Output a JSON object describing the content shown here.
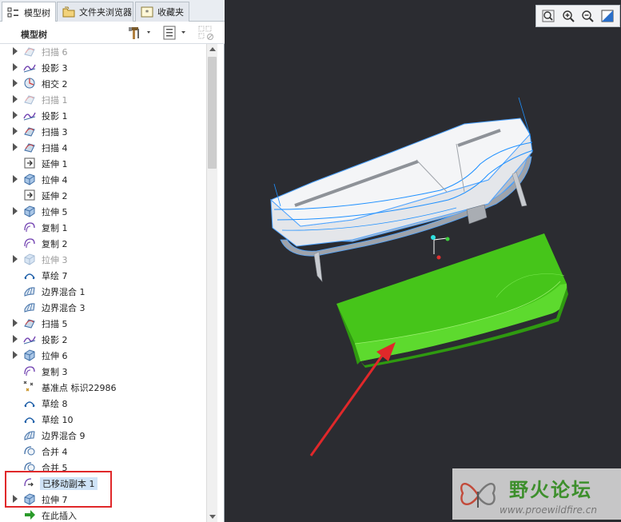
{
  "tabs": [
    {
      "label": "模型树",
      "icon": "tree-icon",
      "active": true
    },
    {
      "label": "文件夹浏览器",
      "icon": "folder-icon",
      "active": false
    },
    {
      "label": "收藏夹",
      "icon": "favorites-icon",
      "active": false
    }
  ],
  "tree_toolbar": {
    "title": "模型树",
    "settings_icon": "hammer-settings-icon",
    "show_icon": "list-show-icon",
    "filter_icon": "filter-icon"
  },
  "tree_items": [
    {
      "label": "扫描 6",
      "icon": "sweep-icon",
      "expandable": true,
      "dim": true
    },
    {
      "label": "投影 3",
      "icon": "project-icon",
      "expandable": true,
      "dim": false
    },
    {
      "label": "相交 2",
      "icon": "intersect-icon",
      "expandable": true,
      "dim": false
    },
    {
      "label": "扫描 1",
      "icon": "sweep-icon",
      "expandable": true,
      "dim": true
    },
    {
      "label": "投影 1",
      "icon": "project-icon",
      "expandable": true,
      "dim": false
    },
    {
      "label": "扫描 3",
      "icon": "sweep-icon",
      "expandable": true,
      "dim": false
    },
    {
      "label": "扫描 4",
      "icon": "sweep-icon",
      "expandable": true,
      "dim": false
    },
    {
      "label": "延伸 1",
      "icon": "extend-icon",
      "expandable": false,
      "dim": false
    },
    {
      "label": "拉伸 4",
      "icon": "extrude-icon",
      "expandable": true,
      "dim": false
    },
    {
      "label": "延伸 2",
      "icon": "extend-icon",
      "expandable": false,
      "dim": false
    },
    {
      "label": "拉伸 5",
      "icon": "extrude-icon",
      "expandable": true,
      "dim": false
    },
    {
      "label": "复制 1",
      "icon": "copy-icon",
      "expandable": false,
      "dim": false
    },
    {
      "label": "复制 2",
      "icon": "copy-icon",
      "expandable": false,
      "dim": false
    },
    {
      "label": "拉伸 3",
      "icon": "extrude-icon",
      "expandable": true,
      "dim": true
    },
    {
      "label": "草绘 7",
      "icon": "sketch-icon",
      "expandable": false,
      "dim": false
    },
    {
      "label": "边界混合 1",
      "icon": "boundary-blend-icon",
      "expandable": false,
      "dim": false
    },
    {
      "label": "边界混合 3",
      "icon": "boundary-blend-icon",
      "expandable": false,
      "dim": false
    },
    {
      "label": "扫描 5",
      "icon": "sweep-icon",
      "expandable": true,
      "dim": false
    },
    {
      "label": "投影 2",
      "icon": "project-icon",
      "expandable": true,
      "dim": false
    },
    {
      "label": "拉伸 6",
      "icon": "extrude-icon",
      "expandable": true,
      "dim": false
    },
    {
      "label": "复制 3",
      "icon": "copy-icon",
      "expandable": false,
      "dim": false
    },
    {
      "label": "基准点 标识22986",
      "icon": "datum-point-icon",
      "expandable": false,
      "dim": false
    },
    {
      "label": "草绘 8",
      "icon": "sketch-icon",
      "expandable": false,
      "dim": false
    },
    {
      "label": "草绘 10",
      "icon": "sketch-icon",
      "expandable": false,
      "dim": false
    },
    {
      "label": "边界混合 9",
      "icon": "boundary-blend-icon",
      "expandable": false,
      "dim": false
    },
    {
      "label": "合并 4",
      "icon": "merge-icon",
      "expandable": false,
      "dim": false
    },
    {
      "label": "合并 5",
      "icon": "merge-icon",
      "expandable": false,
      "dim": false
    },
    {
      "label": "已移动副本 1",
      "icon": "moved-copy-icon",
      "expandable": false,
      "dim": false,
      "selected": true
    },
    {
      "label": "拉伸 7",
      "icon": "extrude-icon",
      "expandable": true,
      "dim": false
    },
    {
      "label": "在此插入",
      "icon": "insert-here-arrow-icon",
      "expandable": false,
      "dim": false
    }
  ],
  "view_tools": [
    {
      "name": "refit-icon"
    },
    {
      "name": "zoom-in-icon"
    },
    {
      "name": "zoom-out-icon"
    },
    {
      "name": "saved-views-icon"
    }
  ],
  "colors": {
    "viewport_bg": "#2b2c31",
    "green_body": "#4ecb1e",
    "annotation_red": "#e0282a",
    "edge_blue": "#1e90ff"
  },
  "watermark": {
    "title": "野火论坛",
    "url": "www.proewildfire.cn"
  }
}
